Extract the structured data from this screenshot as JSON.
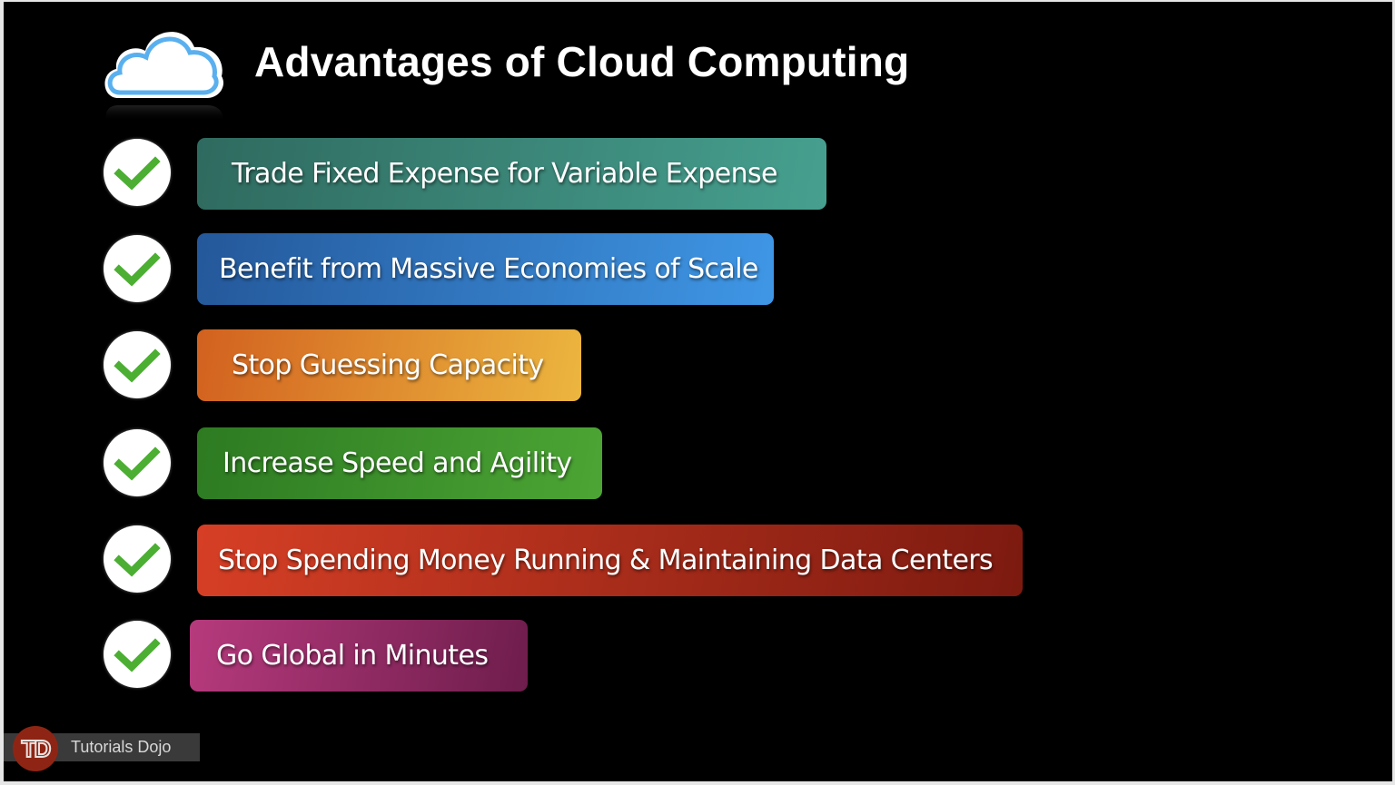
{
  "slide": {
    "title": "Advantages of Cloud Computing",
    "header_icon": "cloud-icon",
    "item_icon": "checkmark-icon",
    "items": [
      {
        "label": "Trade Fixed Expense for Variable Expense",
        "color_start": "#2f6a5f",
        "color_end": "#46a08f"
      },
      {
        "label": "Benefit from Massive Economies of Scale",
        "color_start": "#24589a",
        "color_end": "#3f97e6"
      },
      {
        "label": "Stop Guessing Capacity",
        "color_start": "#d2611f",
        "color_end": "#ecb63f"
      },
      {
        "label": "Increase Speed and Agility",
        "color_start": "#2d7a22",
        "color_end": "#4ca534"
      },
      {
        "label": "Stop Spending Money Running & Maintaining Data Centers",
        "color_start": "#d63f25",
        "color_end": "#7c1a10"
      },
      {
        "label": "Go Global in Minutes",
        "color_start": "#b63a7d",
        "color_end": "#6e1d4c"
      }
    ]
  },
  "watermark": {
    "logo_text": "TD",
    "brand": "Tutorials Dojo",
    "logo_color": "#8e2514"
  },
  "colors": {
    "background": "#000000",
    "check_green": "#4caf33",
    "cloud_outline": "#5ab0ee"
  }
}
